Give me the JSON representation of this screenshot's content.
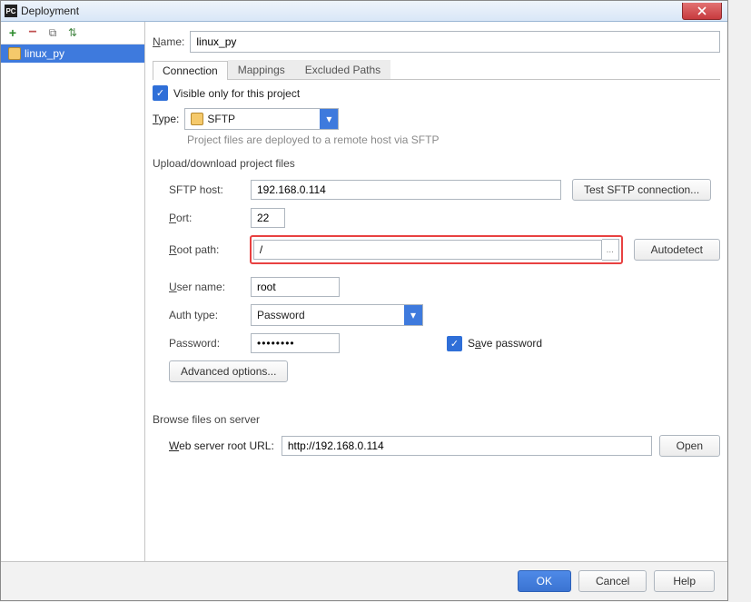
{
  "window": {
    "title": "Deployment",
    "app_icon_text": "PC"
  },
  "sidebar": {
    "toolbar": {
      "add": "+",
      "remove": "−",
      "copy": "⧉",
      "arrange": "⇅"
    },
    "items": [
      {
        "name": "linux_py",
        "selected": true
      }
    ]
  },
  "form": {
    "name_label": "Name:",
    "name_value": "linux_py",
    "tabs": [
      "Connection",
      "Mappings",
      "Excluded Paths"
    ],
    "active_tab": 0,
    "visible_only_label": "Visible only for this project",
    "visible_only_checked": true,
    "type_label": "Type:",
    "type_value": "SFTP",
    "type_hint": "Project files are deployed to a remote host via SFTP",
    "section1_title": "Upload/download project files",
    "sftp_host_label": "SFTP host:",
    "sftp_host_value": "192.168.0.114",
    "test_btn": "Test SFTP connection...",
    "port_label": "Port:",
    "port_value": "22",
    "root_label": "Root path:",
    "root_value": "/",
    "browse_ellipsis": "...",
    "autodetect_btn": "Autodetect",
    "user_label": "User name:",
    "user_value": "root",
    "auth_label": "Auth type:",
    "auth_value": "Password",
    "password_label": "Password:",
    "password_value": "••••••••",
    "save_password_label": "Save password",
    "save_password_checked": true,
    "advanced_btn": "Advanced options...",
    "section2_title": "Browse files on server",
    "web_url_label": "Web server root URL:",
    "web_url_value": "http://192.168.0.114",
    "open_btn": "Open"
  },
  "footer": {
    "ok": "OK",
    "cancel": "Cancel",
    "help": "Help"
  }
}
